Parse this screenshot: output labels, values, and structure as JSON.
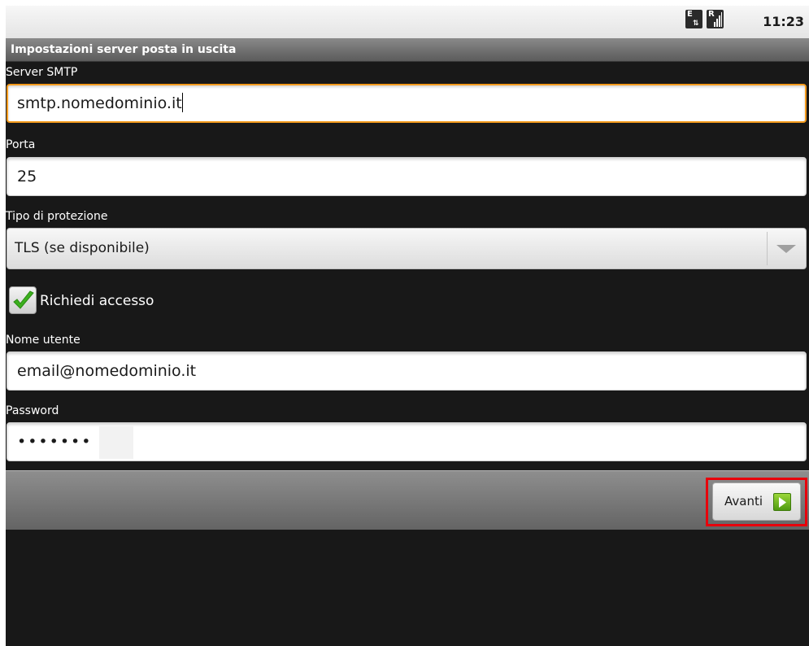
{
  "status_bar": {
    "data_icon_letter": "E",
    "data_icon_arrows": "⇅",
    "signal_icon_letter": "R",
    "time": "11:23"
  },
  "title": "Impostazioni server posta in uscita",
  "smtp_server": {
    "label": "Server SMTP",
    "value": "smtp.nomedominio.it"
  },
  "port": {
    "label": "Porta",
    "value": "25"
  },
  "security_type": {
    "label": "Tipo di protezione",
    "selected": "TLS (se disponibile)"
  },
  "require_login": {
    "label": "Richiedi accesso",
    "checked": true
  },
  "username": {
    "label": "Nome utente",
    "value": "email@nomedominio.it"
  },
  "password": {
    "label": "Password",
    "masked_value": "•••••••"
  },
  "next_button": {
    "label": "Avanti",
    "icon": "right-arrow-icon"
  },
  "colors": {
    "focus_border": "#f39a1c",
    "highlight_box": "#e8000b",
    "checkmark": "#3cb01e",
    "next_icon": "#6ab820"
  }
}
